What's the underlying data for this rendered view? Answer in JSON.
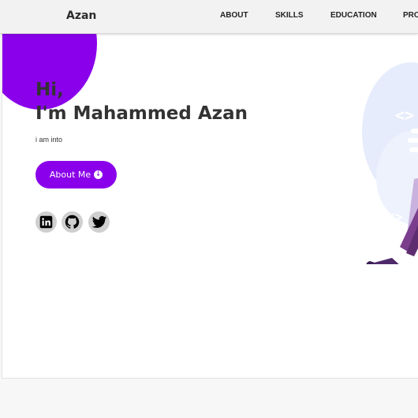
{
  "navbar": {
    "brand": "Azan",
    "links": [
      "ABOUT",
      "SKILLS",
      "EDUCATION",
      "PRO"
    ]
  },
  "hero": {
    "greeting": "Hi,",
    "name": "I'm Mahammed Azan",
    "tagline": "i am into",
    "about_button": "About Me",
    "socials": [
      "linkedin-icon",
      "github-icon",
      "twitter-icon"
    ]
  },
  "colors": {
    "accent": "#8a00ea",
    "text": "#333333",
    "social_bg": "#cfcfcf"
  }
}
